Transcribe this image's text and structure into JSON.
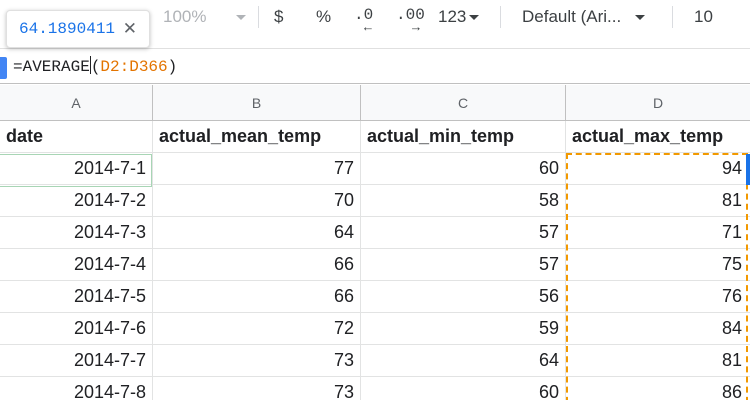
{
  "toolbar": {
    "zoom": "100%",
    "currency": "$",
    "percent": "%",
    "decrease_decimals": ".0",
    "increase_decimals": ".00",
    "more_formats": "123",
    "font_family": "Default (Ari...",
    "font_size": "10",
    "left_arrow": "←",
    "right_arrow": "→"
  },
  "tooltip": {
    "value": "64.1890411",
    "close": "✕"
  },
  "formula_bar": {
    "function": "=AVERAGE",
    "open_paren": "(",
    "range": "D2:D366",
    "close_paren": ")"
  },
  "columns": [
    "A",
    "B",
    "C",
    "D"
  ],
  "headers": [
    "date",
    "actual_mean_temp",
    "actual_min_temp",
    "actual_max_temp"
  ],
  "rows": [
    {
      "date": "2014-7-1",
      "mean": "77",
      "min": "60",
      "max": "94"
    },
    {
      "date": "2014-7-2",
      "mean": "70",
      "min": "58",
      "max": "81"
    },
    {
      "date": "2014-7-3",
      "mean": "64",
      "min": "57",
      "max": "71"
    },
    {
      "date": "2014-7-4",
      "mean": "66",
      "min": "57",
      "max": "75"
    },
    {
      "date": "2014-7-5",
      "mean": "66",
      "min": "56",
      "max": "76"
    },
    {
      "date": "2014-7-6",
      "mean": "72",
      "min": "59",
      "max": "84"
    },
    {
      "date": "2014-7-7",
      "mean": "73",
      "min": "64",
      "max": "81"
    },
    {
      "date": "2014-7-8",
      "mean": "73",
      "min": "60",
      "max": "86"
    }
  ],
  "colors": {
    "accent": "#1a73e8",
    "range_ref": "#e37400",
    "marquee": "#f29900"
  }
}
